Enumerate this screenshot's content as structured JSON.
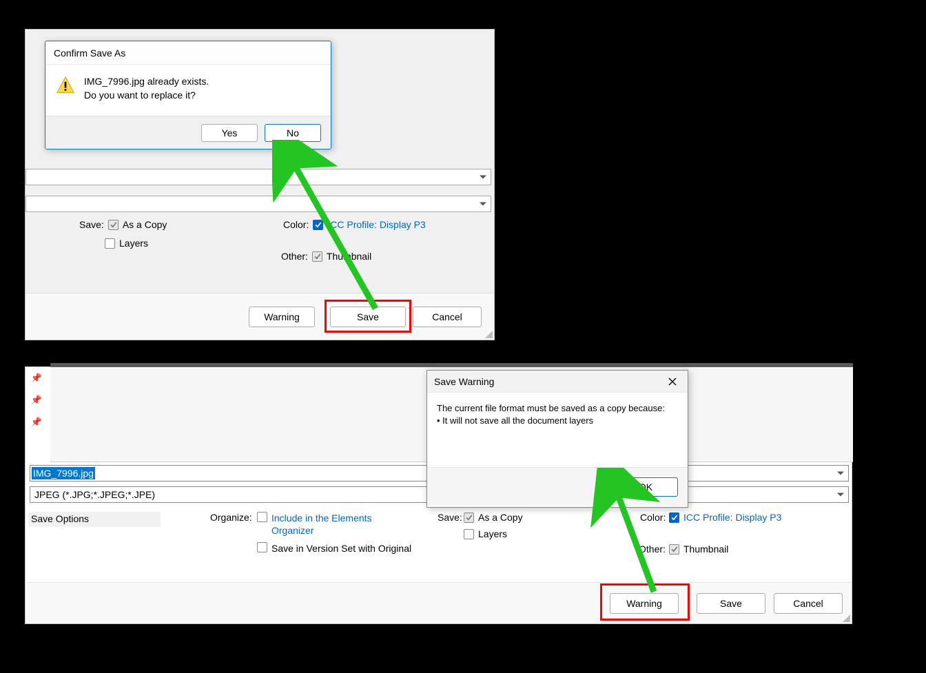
{
  "confirm_dialog": {
    "title": "Confirm Save As",
    "msg_line1": "IMG_7996.jpg already exists.",
    "msg_line2": "Do you want to replace it?",
    "yes": "Yes",
    "no": "No"
  },
  "top": {
    "save_label": "Save:",
    "as_copy": "As a Copy",
    "layers": "Layers",
    "color_label": "Color:",
    "icc_profile": "ICC Profile:  Display P3",
    "other_label": "Other:",
    "thumbnail": "Thumbnail",
    "warning_btn": "Warning",
    "save_btn": "Save",
    "cancel_btn": "Cancel"
  },
  "warning_dialog": {
    "title": "Save Warning",
    "body_line1": "The current file format must be saved as a copy because:",
    "body_line2": "• It will not save all the document layers",
    "ok": "OK"
  },
  "bottom": {
    "filename": "IMG_7996.jpg",
    "filetype": "JPEG (*.JPG;*.JPEG;*.JPE)",
    "save_options_head": "Save Options",
    "organize_label": "Organize:",
    "include_elements": "Include in the Elements Organizer",
    "version_set": "Save in Version Set with Original",
    "save_label": "Save:",
    "as_copy": "As a Copy",
    "layers": "Layers",
    "color_label": "Color:",
    "icc_profile": "ICC Profile:  Display P3",
    "other_label": "Other:",
    "thumbnail": "Thumbnail",
    "warning_btn": "Warning",
    "save_btn": "Save",
    "cancel_btn": "Cancel"
  }
}
